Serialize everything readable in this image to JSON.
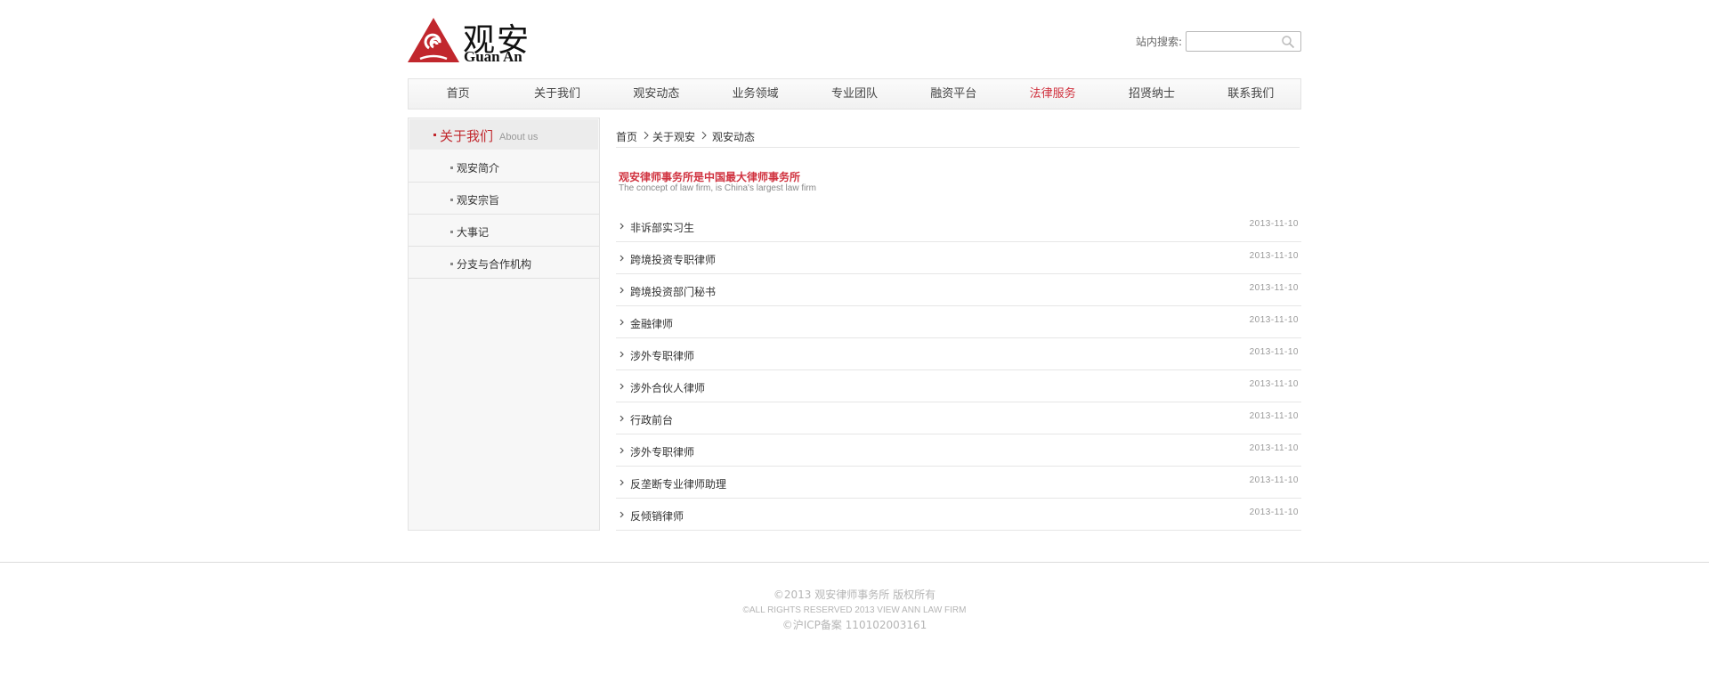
{
  "header": {
    "logo_cn": "观安",
    "logo_en": "Guan An",
    "search_label": "站内搜索:",
    "search_value": "",
    "search_placeholder": ""
  },
  "nav": {
    "items": [
      "首页",
      "关于我们",
      "观安动态",
      "业务领域",
      "专业团队",
      "融资平台",
      "法律服务",
      "招贤纳士",
      "联系我们"
    ],
    "active": "法律服务"
  },
  "sidebar": {
    "title": "关于我们",
    "title_en": "About us",
    "items": [
      "观安简介",
      "观安宗旨",
      "大事记",
      "分支与合作机构"
    ]
  },
  "breadcrumb": {
    "items": [
      "首页",
      "关于观安",
      "观安动态"
    ],
    "separator": ">"
  },
  "headline": {
    "cn": "观安律师事务所是中国最大律师事务所",
    "en": "The concept of law firm, is China's largest law firm"
  },
  "list": {
    "rows": [
      {
        "title": "非诉部实习生",
        "date": "2013-11-10"
      },
      {
        "title": "跨境投资专职律师",
        "date": "2013-11-10"
      },
      {
        "title": "跨境投资部门秘书",
        "date": "2013-11-10"
      },
      {
        "title": "金融律师",
        "date": "2013-11-10"
      },
      {
        "title": "涉外专职律师",
        "date": "2013-11-10"
      },
      {
        "title": "涉外合伙人律师",
        "date": "2013-11-10"
      },
      {
        "title": "行政前台",
        "date": "2013-11-10"
      },
      {
        "title": "涉外专职律师",
        "date": "2013-11-10"
      },
      {
        "title": "反垄断专业律师助理",
        "date": "2013-11-10"
      },
      {
        "title": "反倾销律师",
        "date": "2013-11-10"
      }
    ]
  },
  "footer": {
    "line1": "©2013  观安律师事务所  版权所有",
    "line2": "©ALL RIGHTS RESERVED 2013 VIEW ANN LAW FIRM",
    "line3": "©沪ICP备案  110102003161"
  },
  "colors": {
    "accent": "#d0323f",
    "logo_red": "#c1272d",
    "text": "#333333",
    "muted": "#999999"
  }
}
